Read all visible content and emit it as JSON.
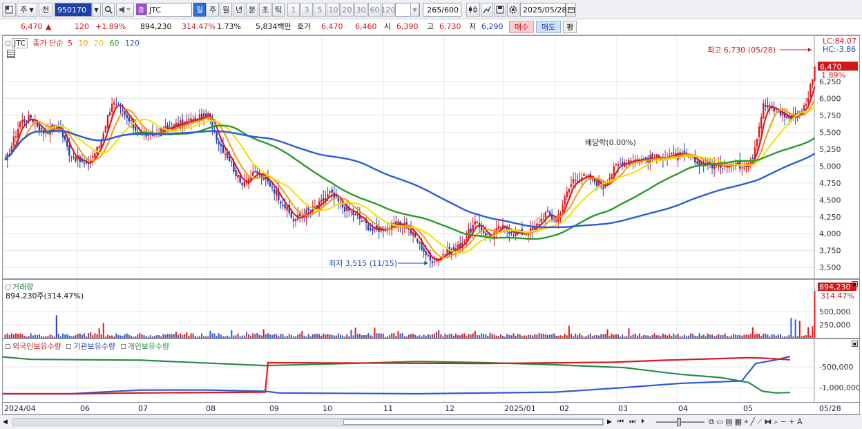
{
  "toolbar": {
    "period_buttons": [
      "일",
      "주",
      "월",
      "년",
      "분",
      "초",
      "틱"
    ],
    "interval_buttons": [
      "1",
      "3",
      "5",
      "10",
      "20",
      "30",
      "60",
      "120"
    ],
    "type_label": "주",
    "kind_label": "전",
    "code": "950170",
    "name": "JTC",
    "prefix": "종",
    "count": "265",
    "count_max": "/600",
    "date": "2025/05/28"
  },
  "quote": {
    "price": "6,470",
    "arrow": "▲",
    "change": "120",
    "change_pct": "+1.89%",
    "volume": "894,230",
    "volume_ratio": "314.47%",
    "turnover": "1.73%",
    "amount": "5,834백만",
    "hoga_label": "호가",
    "ask": "6,470",
    "bid": "6,460",
    "open_label": "시",
    "open": "6,390",
    "high_label": "고",
    "high": "6,730",
    "low_label": "저",
    "low": "6,290",
    "buy": "매수",
    "sell": "매도",
    "avg": "평"
  },
  "price_panel": {
    "symbol": "JTC",
    "ma_label": "종가 단순",
    "ma_periods": [
      "5",
      "10",
      "20",
      "60",
      "120"
    ],
    "ma_colors": [
      "#e01818",
      "#f29a12",
      "#f0e000",
      "#2a9a2a",
      "#2b5bd8"
    ],
    "lc": "LC:84.07",
    "hc": "HC:-3.86",
    "high_note": "최고 6,730 (05/28)",
    "low_note": "최저 3,515 (11/15)",
    "dividend_note": "배당락(0.00%)",
    "last_price": "6,470",
    "last_pct": "1.89%",
    "y_labels": [
      "6,250",
      "6,000",
      "5,750",
      "5,500",
      "5,250",
      "5,000",
      "4,750",
      "4,500",
      "4,250",
      "4,000",
      "3,750",
      "3,500"
    ]
  },
  "volume_panel": {
    "title": "거래량",
    "summary": "894,230주(314.47%)",
    "last_volume": "894,230",
    "last_pct": "314.47%",
    "y_labels": [
      "500,000",
      "250,000"
    ]
  },
  "holding_panel": {
    "series": [
      {
        "name": "외국인보유수량",
        "color": "#e01818"
      },
      {
        "name": "기관보유수량",
        "color": "#2b5bd8"
      },
      {
        "name": "개인보유수량",
        "color": "#2a8a4a"
      }
    ],
    "y_labels": [
      "-500,000",
      "-1,000,000"
    ]
  },
  "x_axis": {
    "labels": [
      "2024/04",
      "06",
      "07",
      "08",
      "09",
      "10",
      "11",
      "12",
      "2025/01",
      "02",
      "03",
      "04",
      "05",
      "05/28"
    ]
  },
  "chart_data": [
    {
      "type": "candlestick",
      "title": "JTC",
      "x_start": "2024/04",
      "x_end": "2025/05/28",
      "ylim": [
        3400,
        6800
      ],
      "annotations": [
        {
          "label": "최고",
          "value": 6730,
          "date": "05/28"
        },
        {
          "label": "최저",
          "value": 3515,
          "date": "11/15"
        }
      ],
      "series": [
        {
          "name": "종가",
          "waypoints": [
            [
              0,
              5050
            ],
            [
              7,
              5650
            ],
            [
              12,
              5720
            ],
            [
              18,
              5500
            ],
            [
              25,
              5600
            ],
            [
              30,
              5200
            ],
            [
              38,
              5000
            ],
            [
              44,
              5300
            ],
            [
              50,
              5950
            ],
            [
              57,
              5700
            ],
            [
              62,
              5500
            ],
            [
              68,
              5450
            ],
            [
              75,
              5550
            ],
            [
              85,
              5650
            ],
            [
              95,
              5750
            ],
            [
              100,
              5350
            ],
            [
              105,
              5100
            ],
            [
              110,
              4750
            ],
            [
              118,
              4900
            ],
            [
              125,
              4700
            ],
            [
              130,
              4450
            ],
            [
              135,
              4200
            ],
            [
              140,
              4300
            ],
            [
              146,
              4400
            ],
            [
              152,
              4600
            ],
            [
              158,
              4400
            ],
            [
              165,
              4250
            ],
            [
              172,
              4050
            ],
            [
              180,
              4100
            ],
            [
              187,
              4150
            ],
            [
              193,
              3900
            ],
            [
              199,
              3600
            ],
            [
              205,
              3700
            ],
            [
              212,
              3800
            ],
            [
              220,
              4150
            ],
            [
              227,
              3950
            ],
            [
              232,
              4100
            ],
            [
              240,
              4000
            ],
            [
              247,
              4050
            ],
            [
              253,
              4300
            ],
            [
              258,
              4200
            ],
            [
              263,
              4600
            ],
            [
              266,
              4800
            ],
            [
              270,
              4850
            ],
            [
              275,
              4800
            ],
            [
              280,
              4700
            ],
            [
              286,
              5000
            ],
            [
              292,
              5100
            ],
            [
              300,
              5100
            ],
            [
              310,
              5150
            ],
            [
              318,
              5150
            ],
            [
              325,
              5050
            ],
            [
              334,
              5000
            ],
            [
              340,
              5050
            ],
            [
              345,
              5000
            ],
            [
              350,
              5150
            ],
            [
              355,
              5900
            ],
            [
              362,
              5800
            ],
            [
              368,
              5700
            ],
            [
              375,
              5900
            ],
            [
              379,
              6470
            ]
          ]
        }
      ]
    },
    {
      "type": "bar",
      "title": "거래량",
      "y_ticks": [
        250000,
        500000
      ],
      "last": 894230
    },
    {
      "type": "line",
      "title": "보유수량",
      "y_ticks": [
        -500000,
        -1000000
      ],
      "series": [
        {
          "name": "외국인보유수량"
        },
        {
          "name": "기관보유수량"
        },
        {
          "name": "개인보유수량"
        }
      ]
    }
  ]
}
